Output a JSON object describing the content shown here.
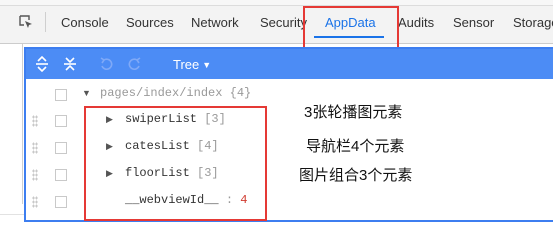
{
  "tabs": [
    {
      "label": "Console"
    },
    {
      "label": "Sources"
    },
    {
      "label": "Network"
    },
    {
      "label": "Security"
    },
    {
      "label": "AppData",
      "active": true
    },
    {
      "label": "Audits"
    },
    {
      "label": "Sensor"
    },
    {
      "label": "Storage"
    }
  ],
  "toolbar": {
    "view_mode": "Tree",
    "icons": [
      "expand-all-icon",
      "collapse-all-icon",
      "undo-icon",
      "redo-icon"
    ]
  },
  "tree": {
    "root_path": "pages/index/index",
    "root_count": "{4}",
    "items": [
      {
        "key": "swiperList",
        "count": "[3]"
      },
      {
        "key": "catesList",
        "count": "[4]"
      },
      {
        "key": "floorList",
        "count": "[3]"
      },
      {
        "key": "__webviewId__",
        "sep": ":",
        "value": "4"
      }
    ]
  },
  "annotations": [
    "3张轮播图元素",
    "导航栏4个元素",
    "图片组合3个元素"
  ],
  "colors": {
    "accent": "#1a73e8",
    "toolbar": "#4c8cf5",
    "highlight": "#e53935"
  }
}
